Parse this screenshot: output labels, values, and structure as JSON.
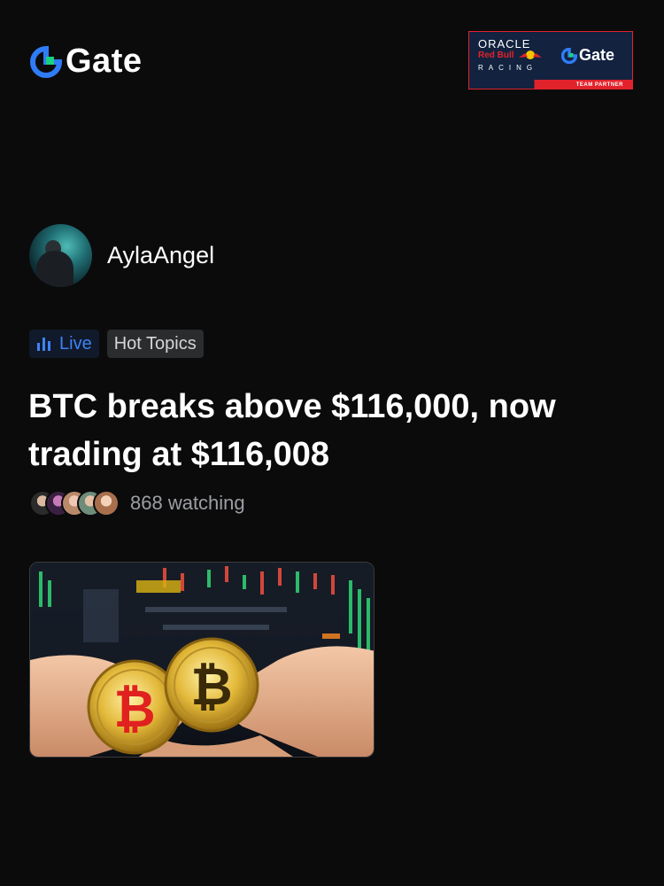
{
  "brand": {
    "name": "Gate",
    "accent": "#3d83f5",
    "logo_green": "#19d17f"
  },
  "partner_banner": {
    "line1": "ORACLE",
    "line2": "Red Bull",
    "line3": "RACING",
    "brand": "Gate",
    "ribbon": "TEAM PARTNER"
  },
  "author": {
    "name": "AylaAngel"
  },
  "tags": {
    "live": "Live",
    "topic": "Hot Topics"
  },
  "post": {
    "headline": "BTC breaks above $116,000, now trading at $116,008",
    "watching": "868 watching"
  },
  "colors": {
    "background": "#0b0b0c",
    "live_tag_bg": "#111a2a",
    "topic_tag_bg": "#2b2c2e",
    "muted_text": "#9c9ea3"
  }
}
